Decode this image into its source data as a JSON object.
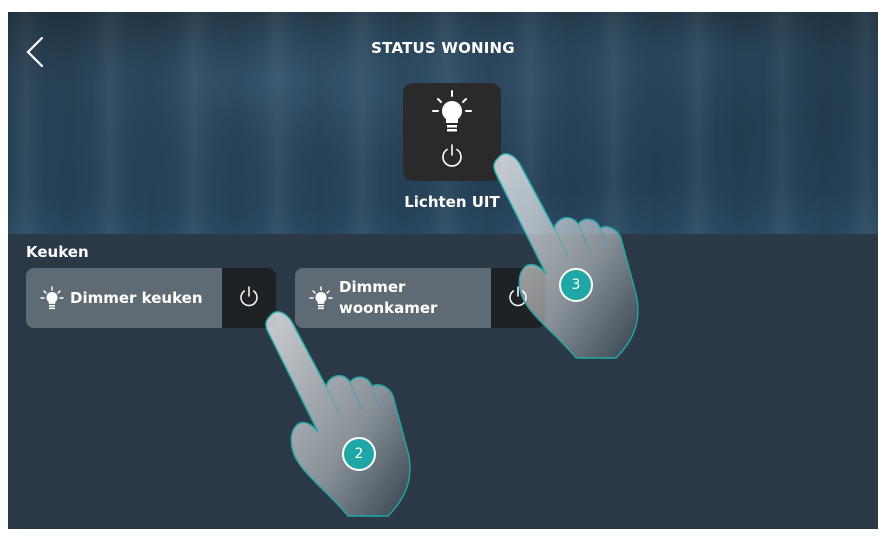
{
  "header": {
    "title": "STATUS WONING"
  },
  "scene": {
    "label": "Lichten UIT"
  },
  "section": {
    "title": "Keuken"
  },
  "dimmers": [
    {
      "label_line1": "Dimmer keuken"
    },
    {
      "label_line1": "Dimmer",
      "label_line2": "woonkamer"
    }
  ],
  "steps": {
    "step2": "2",
    "step3": "3"
  },
  "colors": {
    "tile": "#2a2a2a",
    "dimmer_bg": "#5f6b74",
    "badge": "#1fa7a8"
  },
  "icons": [
    "back-arrow-icon",
    "light-bulb-icon",
    "power-icon",
    "hand-pointer-icon"
  ]
}
